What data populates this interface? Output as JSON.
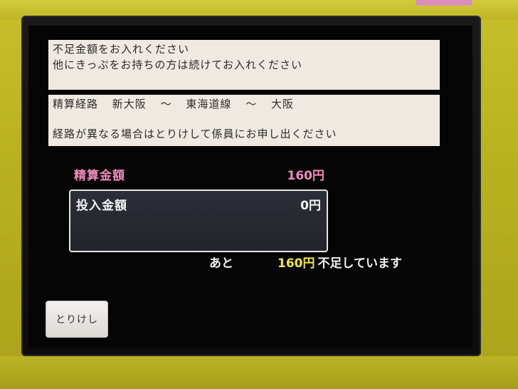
{
  "messages": {
    "line1": "不足金額をお入れください",
    "line2": "他にきっぷをお持ちの方は続けてお入れください"
  },
  "route": {
    "label": "精算経路",
    "origin": "新大阪",
    "separator1": "～",
    "line": "東海道線",
    "separator2": "～",
    "destination": "大阪",
    "notice": "経路が異なる場合はとりけして係員にお申し出ください"
  },
  "fare": {
    "label": "精算金額",
    "value": "160円"
  },
  "inserted": {
    "label": "投入金額",
    "value": "0円"
  },
  "remaining": {
    "prefix": "あと",
    "amount": "160円",
    "suffix": "不足しています"
  },
  "buttons": {
    "cancel": "とりけし"
  },
  "colors": {
    "housing": "#bdb526",
    "fare_pink": "#f08bbd",
    "amount_yellow": "#f2e64a",
    "screen": "#050505"
  }
}
